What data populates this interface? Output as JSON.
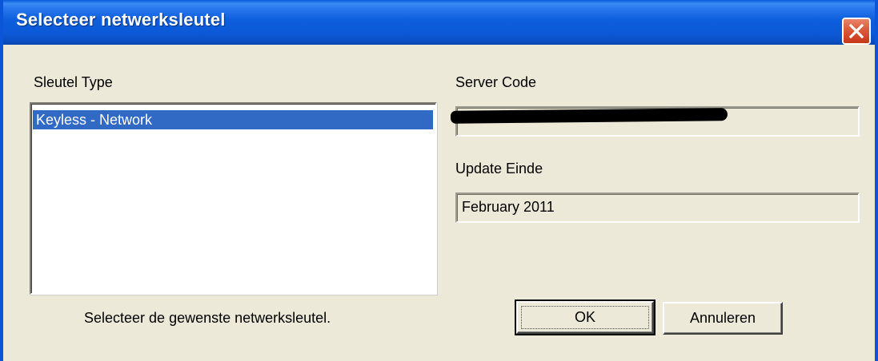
{
  "window": {
    "title": "Selecteer netwerksleutel"
  },
  "left_panel": {
    "list_label": "Sleutel Type",
    "items": [
      {
        "label": "Keyless - Network",
        "selected": true
      }
    ],
    "hint": "Selecteer de gewenste netwerksleutel."
  },
  "right_panel": {
    "server_code_label": "Server Code",
    "server_code_value": "[redacted]",
    "update_end_label": "Update Einde",
    "update_end_value": "February 2011"
  },
  "buttons": {
    "ok_label": "OK",
    "cancel_label": "Annuleren"
  },
  "colors": {
    "titlebar": "#0c59d6",
    "selection": "#316ac5",
    "dialog_bg": "#ece9d8",
    "close_button": "#dc5d3c"
  },
  "icons": {
    "close": "close-icon"
  }
}
